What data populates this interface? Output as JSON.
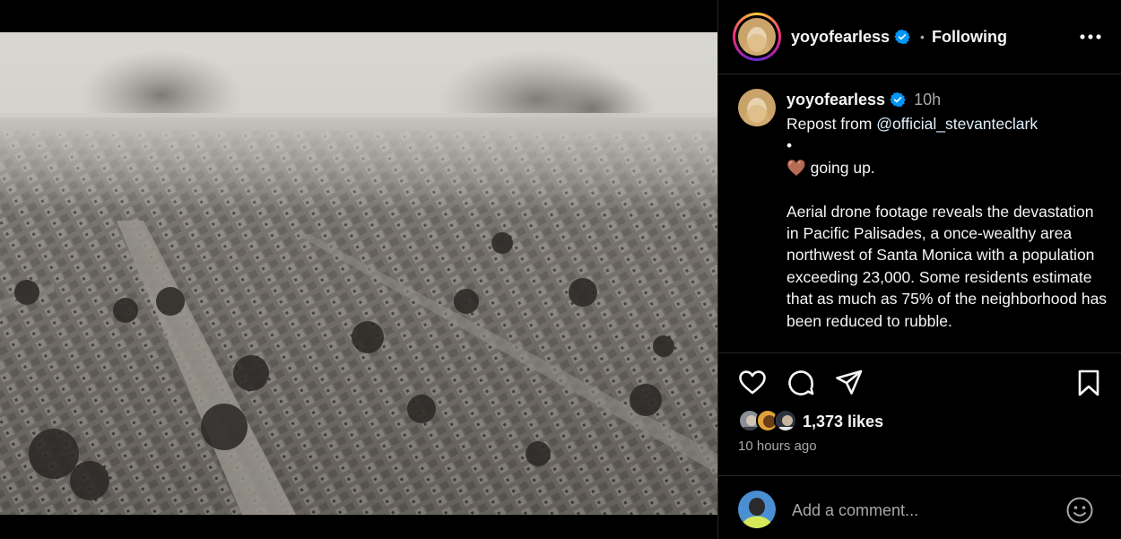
{
  "post": {
    "username": "yoyofearless",
    "dot": "•",
    "following_label": "Following",
    "more_icon": "more-horizontal-icon"
  },
  "caption": {
    "username": "yoyofearless",
    "time": "10h",
    "repost_prefix": "Repost from ",
    "mention": "@official_stevanteclark",
    "body": "•\n🤎 going up.\n\nAerial drone footage reveals the devastation in Pacific Palisades, a once-wealthy area northwest of Santa Monica with a population exceeding 23,000. Some residents estimate that as much as 75% of the neighborhood has been reduced to rubble."
  },
  "actions": {
    "like_icon": "heart-icon",
    "comment_icon": "comment-icon",
    "share_icon": "share-icon",
    "save_icon": "bookmark-icon"
  },
  "likes": {
    "count_label": "1,373 likes",
    "time_ago": "10 hours ago"
  },
  "comment": {
    "placeholder": "Add a comment...",
    "emoji_icon": "emoji-icon"
  },
  "colors": {
    "background": "#000000",
    "text": "#f5f5f5",
    "muted": "#a8a8a8",
    "verified": "#0095f6",
    "mention": "#e0f1ff"
  }
}
